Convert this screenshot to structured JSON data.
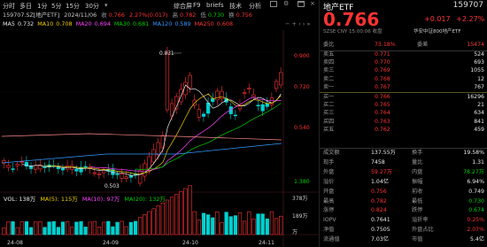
{
  "topbar": {
    "tabs": [
      "分时",
      "多日",
      "1分",
      "5分",
      "15分",
      "30分"
    ],
    "period_dropdown": "▾",
    "right_tabs": [
      "综合屏",
      "F9",
      "briefs",
      "技术",
      "分析"
    ],
    "icons": [
      "window-icon",
      "gear-icon",
      "expand-icon"
    ]
  },
  "info_strip": {
    "code": "159707.SZ[地产ETF]",
    "date": "2024/11/06",
    "open_label": "收",
    "open_value": "0.766",
    "chg_pct": "2.27%(0.017)",
    "high_label": "高",
    "high_value": "0.782",
    "low_label": "低",
    "low_value": "0.730",
    "vol_label": "换",
    "vol_value": "0.756"
  },
  "ma_bar": [
    {
      "label": "MA5",
      "value": "0.732",
      "color": "#e8e8e8"
    },
    {
      "label": "MA10",
      "value": "0.708",
      "color": "#f0d000"
    },
    {
      "label": "MA20",
      "value": "0.694",
      "color": "#ff44ff"
    },
    {
      "label": "MA30",
      "value": "0.681",
      "color": "#00d000"
    },
    {
      "label": "MA120",
      "value": "0.589",
      "color": "#3399ff"
    },
    {
      "label": "MA250",
      "value": "0.608",
      "color": "#ff3333"
    }
  ],
  "toolbar_icons": [
    "minus-icon",
    "plus-icon",
    "left-icon",
    "right-icon",
    "chevron-right-icon"
  ],
  "price_axis": [
    "0.900",
    "0.720",
    "0.540",
    "1.380"
  ],
  "high_marker": "0.831",
  "low_marker": "0.503",
  "vol_bar": {
    "vol": "VOL: 138万",
    "ma5": "MA(5): 115万",
    "ma10": "MA(10): 97万",
    "ma20": "MA(20): 132万"
  },
  "vol_axis": [
    "378万",
    "189万",
    "万"
  ],
  "date_axis": [
    "24-08",
    "24-09",
    "24-10",
    "24-11"
  ],
  "quote": {
    "name": "地产ETF",
    "code": "159707",
    "price": "0.766",
    "change": "+0.017",
    "change_pct": "+2.27%",
    "sub": "SZSE  CNY  15:00:06  收盘",
    "sub_right": "华安中证800地产ETF",
    "weibi_label": "委比",
    "weibi_value": "73.18%",
    "weicha_label": "委差",
    "weicha_value": "15474",
    "asks": [
      {
        "label": "卖五",
        "price": "0.771",
        "vol": "524"
      },
      {
        "label": "卖四",
        "price": "0.770",
        "vol": "693"
      },
      {
        "label": "卖三",
        "price": "0.769",
        "vol": "1055"
      },
      {
        "label": "卖二",
        "price": "0.768",
        "vol": "12"
      },
      {
        "label": "卖一",
        "price": "0.767",
        "vol": "767"
      }
    ],
    "bids": [
      {
        "label": "买一",
        "price": "0.766",
        "vol": "16296"
      },
      {
        "label": "买二",
        "price": "0.765",
        "vol": "21"
      },
      {
        "label": "买三",
        "price": "0.764",
        "vol": "634"
      },
      {
        "label": "买四",
        "price": "0.763",
        "vol": "841"
      },
      {
        "label": "买五",
        "price": "0.762",
        "vol": "459"
      }
    ],
    "stats": [
      {
        "l1": "成交额",
        "v1": "137.55万",
        "c1": "white",
        "l2": "换手",
        "v2": "19.58%",
        "c2": "white"
      },
      {
        "l1": "现手",
        "v1": "7458",
        "c1": "white",
        "l2": "量比",
        "v2": "1.31",
        "c2": "white"
      },
      {
        "l1": "外盘",
        "v1": "59.27万",
        "c1": "red",
        "l2": "内盘",
        "v2": "78.27万",
        "c2": "green"
      },
      {
        "l1": "溢价",
        "v1": "1.04亿",
        "c1": "white",
        "l2": "振幅",
        "v2": "6.94%",
        "c2": "white"
      },
      {
        "l1": "开盘",
        "v1": "0.756",
        "c1": "red",
        "l2": "前收",
        "v2": "0.749",
        "c2": "white"
      },
      {
        "l1": "最高",
        "v1": "0.782",
        "c1": "red",
        "l2": "最低",
        "v2": "0.730",
        "c2": "green"
      },
      {
        "l1": "涨停",
        "v1": "0.824",
        "c1": "red",
        "l2": "跌停",
        "v2": "0.674",
        "c2": "green"
      },
      {
        "l1": "IOPV",
        "v1": "0.7641",
        "c1": "white",
        "l2": "溢折率",
        "v2": "0.25%",
        "c2": "red"
      },
      {
        "l1": "净值",
        "v1": "0.7505",
        "c1": "white",
        "l2": "外盘占比",
        "v2": "2.07%",
        "c2": "red"
      },
      {
        "l1": "流通值",
        "v1": "7.03亿",
        "c1": "white",
        "l2": "市值",
        "v2": "5.4亿",
        "c2": "white"
      }
    ]
  },
  "colors": {
    "up": "#ff3333",
    "down": "#00d000",
    "bg": "#000000",
    "grid": "#2a1a1a"
  }
}
